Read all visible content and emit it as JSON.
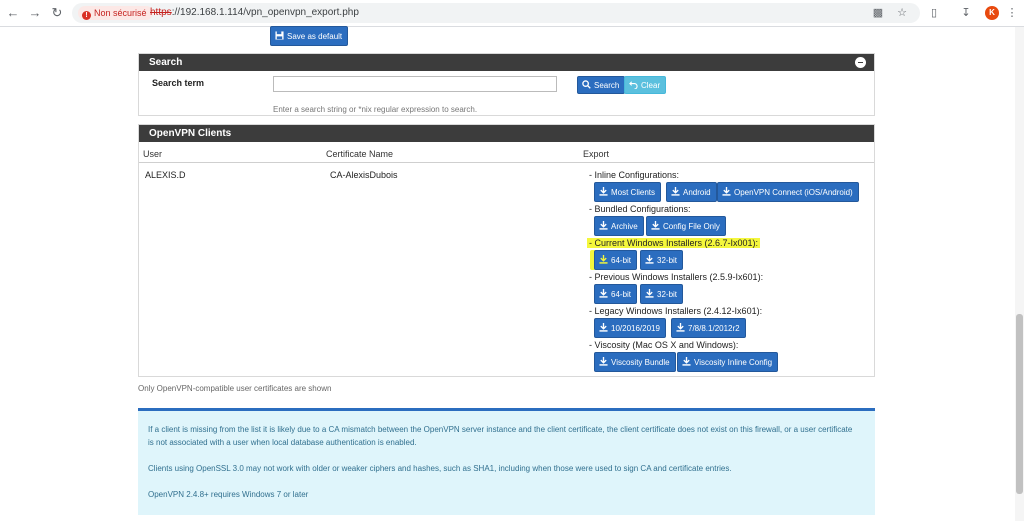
{
  "browser": {
    "security_label": "Non sécurisé",
    "url_scheme": "https",
    "url_rest": "://192.168.1.114/vpn_openvpn_export.php",
    "avatar_letter": "K"
  },
  "toolbar": {
    "save_default_label": "Save as default"
  },
  "search": {
    "heading": "Search",
    "term_label": "Search term",
    "input_value": "",
    "help_text": "Enter a search string or *nix regular expression to search.",
    "search_button": "Search",
    "clear_button": "Clear"
  },
  "clients": {
    "heading": "OpenVPN Clients",
    "columns": [
      "User",
      "Certificate Name",
      "Export"
    ],
    "rows": [
      {
        "user": "ALEXIS.D",
        "certificate": "CA-AlexisDubois"
      }
    ],
    "groups": [
      {
        "label": "- Inline Configurations:",
        "buttons": [
          "Most Clients",
          "Android",
          "OpenVPN Connect (iOS/Android)"
        ]
      },
      {
        "label": "- Bundled Configurations:",
        "buttons": [
          "Archive",
          "Config File Only"
        ]
      },
      {
        "label": "- Current Windows Installers (2.6.7-Ix001):",
        "buttons": [
          "64-bit",
          "32-bit"
        ]
      },
      {
        "label": "- Previous Windows Installers (2.5.9-Ix601):",
        "buttons": [
          "64-bit",
          "32-bit"
        ]
      },
      {
        "label": "- Legacy Windows Installers (2.4.12-Ix601):",
        "buttons": [
          "10/2016/2019",
          "7/8/8.1/2012r2"
        ]
      },
      {
        "label": "- Viscosity (Mac OS X and Windows):",
        "buttons": [
          "Viscosity Bundle",
          "Viscosity Inline Config"
        ]
      }
    ]
  },
  "note": "Only OpenVPN-compatible user certificates are shown",
  "info": {
    "p1": "If a client is missing from the list it is likely due to a CA mismatch between the OpenVPN server instance and the client certificate, the client certificate does not exist on this firewall, or a user certificate is not associated with a user when local database authentication is enabled.",
    "p2": "Clients using OpenSSL 3.0 may not work with older or weaker ciphers and hashes, such as SHA1, including when those were used to sign CA and certificate entries.",
    "p3": "OpenVPN 2.4.8+ requires Windows 7 or later"
  },
  "colors": {
    "accent": "#2b6dbf",
    "panel_heading": "#3c3c3c",
    "info_bg": "#dff5fb",
    "highlight": "#f4f73c"
  }
}
